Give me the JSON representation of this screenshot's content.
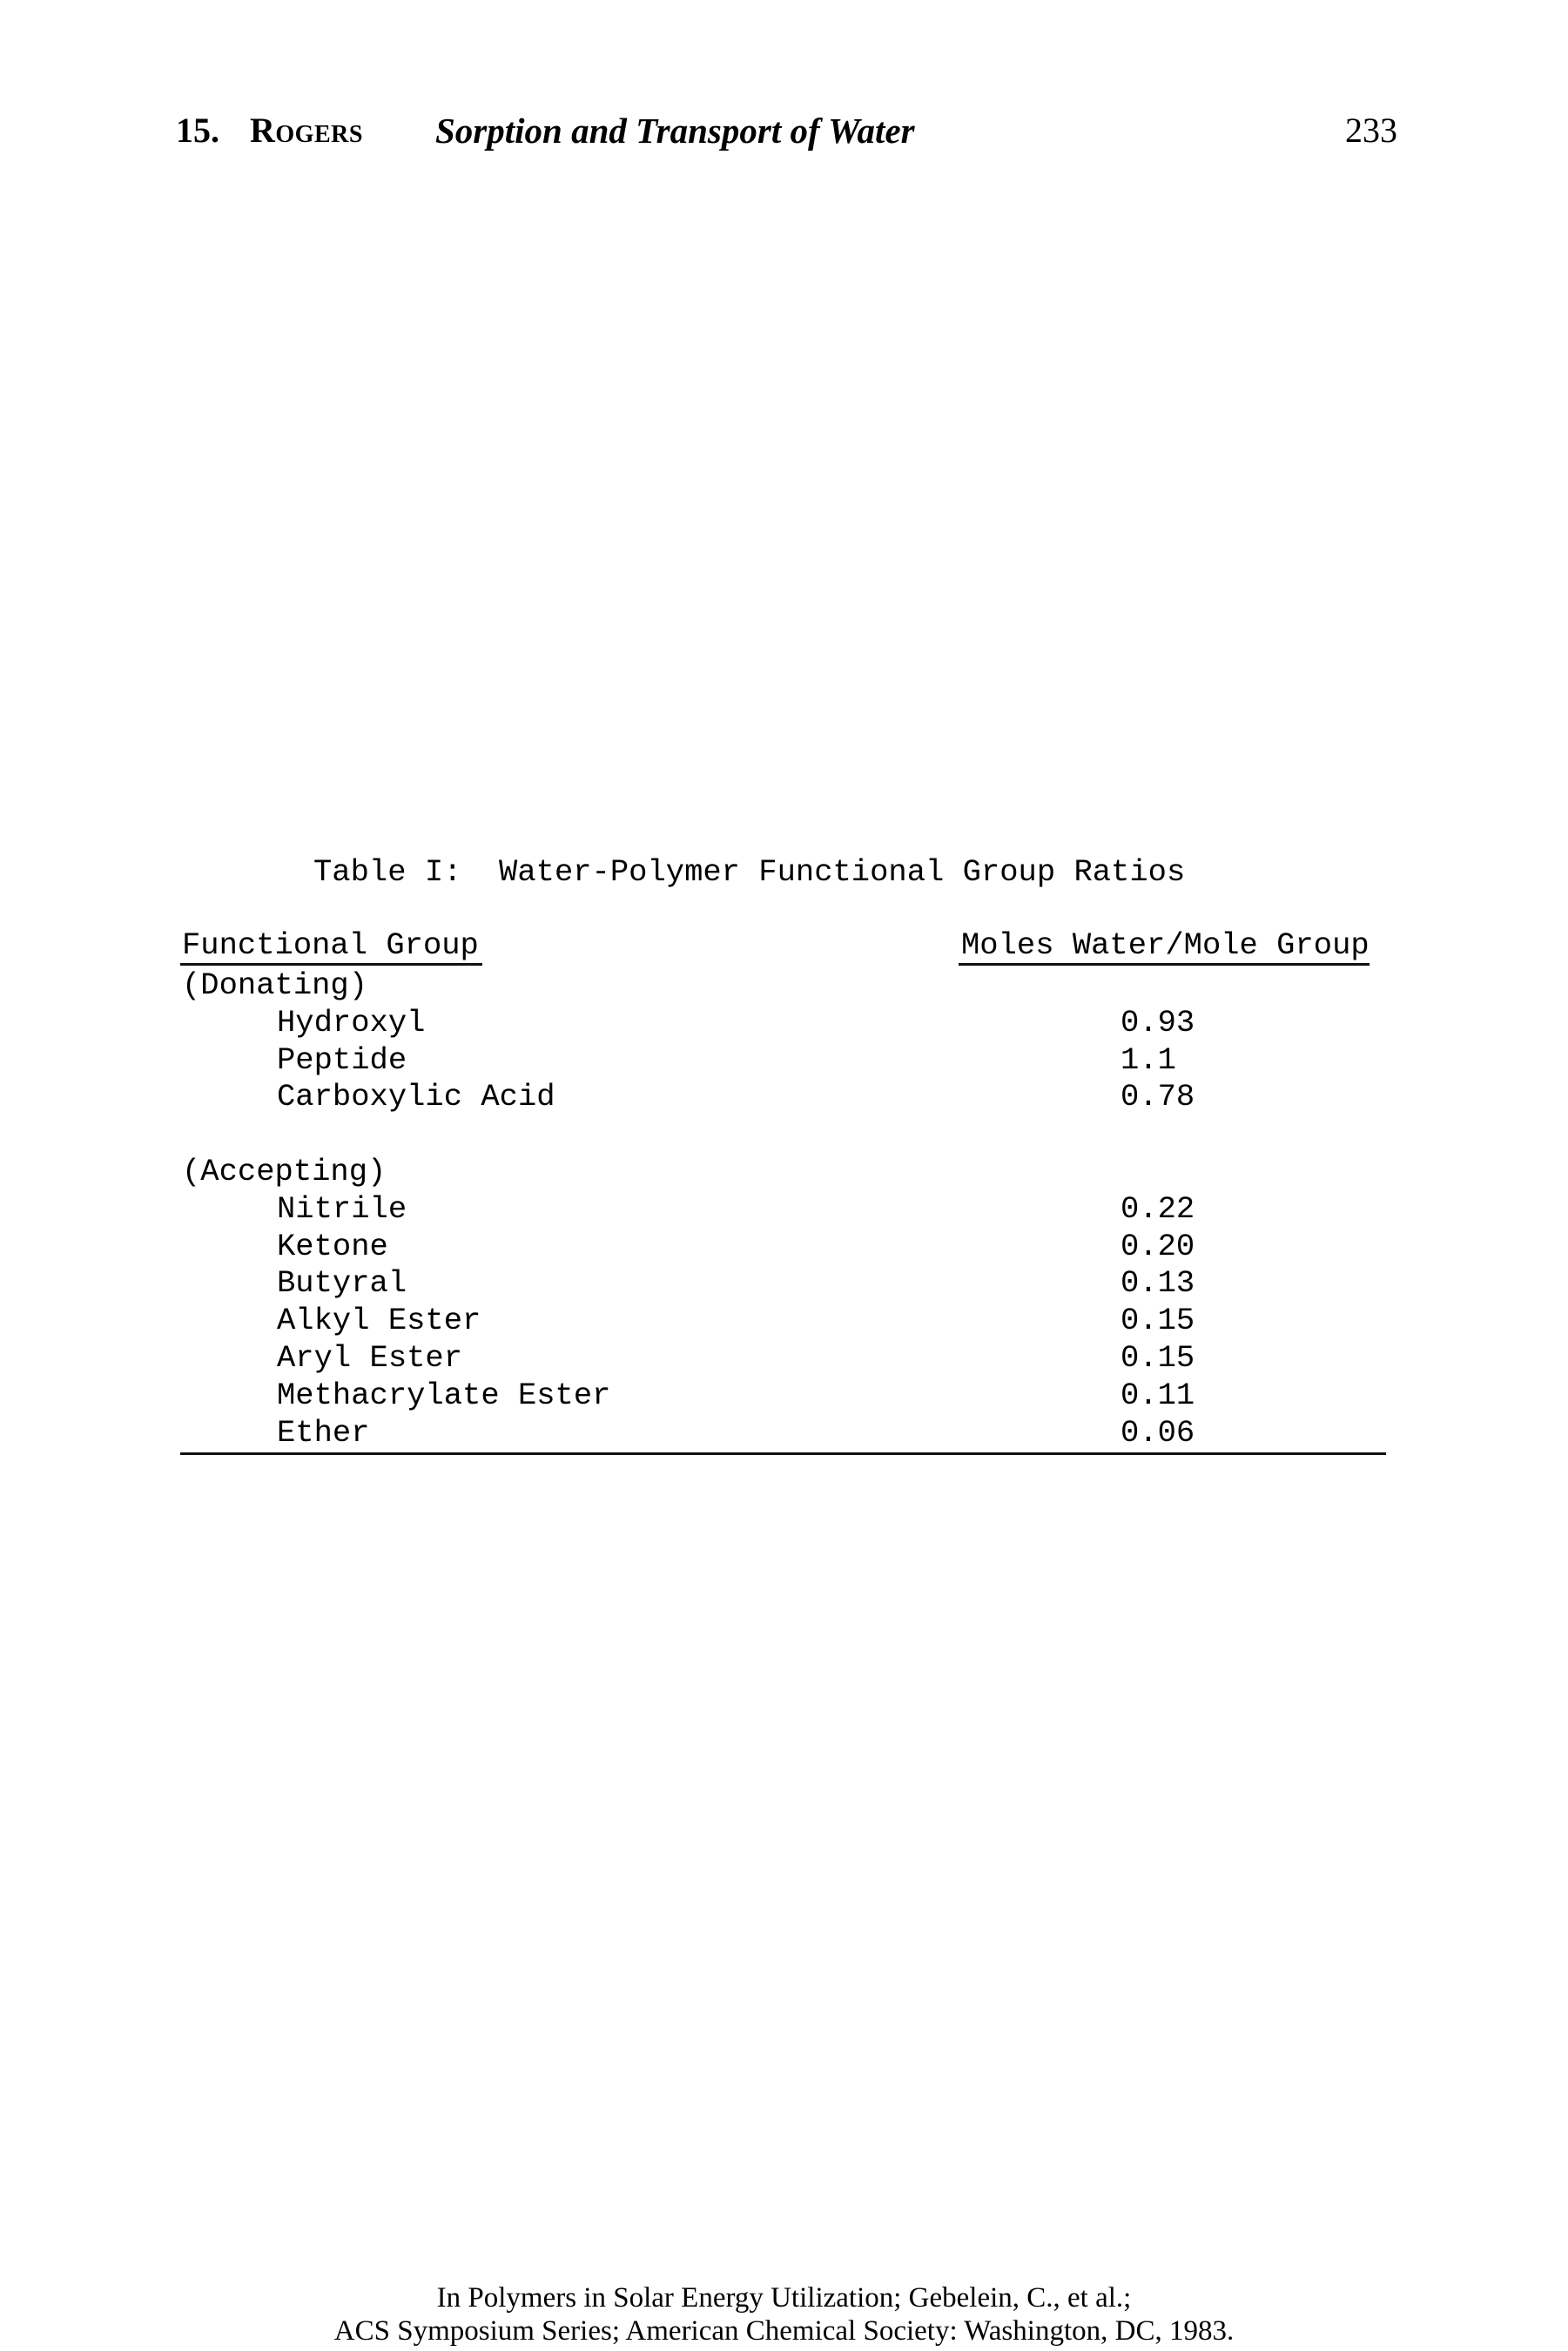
{
  "running_head": {
    "chapter_number": "15.",
    "author": "Rogers",
    "title": "Sorption and Transport of Water",
    "page_number": "233"
  },
  "table": {
    "title": "Table I:  Water-Polymer Functional Group Ratios",
    "columns": [
      "Functional Group",
      "Moles Water/Mole Group"
    ],
    "rows": [
      {
        "type": "section",
        "label": "(Donating)",
        "value": ""
      },
      {
        "type": "item",
        "label": "Hydroxyl",
        "value": "0.93"
      },
      {
        "type": "item",
        "label": "Peptide",
        "value": "1.1"
      },
      {
        "type": "item",
        "label": "Carboxylic Acid",
        "value": "0.78"
      },
      {
        "type": "blank",
        "label": "",
        "value": ""
      },
      {
        "type": "section",
        "label": "(Accepting)",
        "value": ""
      },
      {
        "type": "item",
        "label": "Nitrile",
        "value": "0.22"
      },
      {
        "type": "item",
        "label": "Ketone",
        "value": "0.20"
      },
      {
        "type": "item",
        "label": "Butyral",
        "value": "0.13"
      },
      {
        "type": "item",
        "label": "Alkyl Ester",
        "value": "0.15"
      },
      {
        "type": "item",
        "label": "Aryl Ester",
        "value": "0.15"
      },
      {
        "type": "item",
        "label": "Methacrylate Ester",
        "value": "0.11"
      },
      {
        "type": "item",
        "label": "Ether",
        "value": "0.06"
      }
    ]
  },
  "footer": {
    "line1": "In Polymers in Solar Energy Utilization; Gebelein, C., et al.;",
    "line2": "ACS Symposium Series; American Chemical Society: Washington, DC, 1983."
  }
}
